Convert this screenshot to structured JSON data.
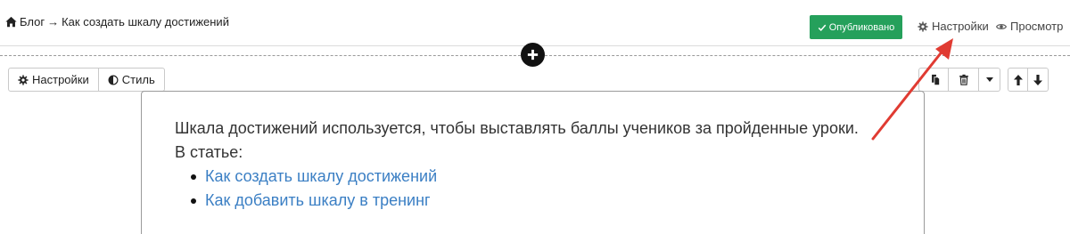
{
  "breadcrumb": {
    "section": "Блог",
    "separator": "→",
    "page": "Как создать шкалу достижений"
  },
  "topbar": {
    "publish_label": "Опубликовано",
    "settings_label": "Настройки",
    "preview_label": "Просмотр"
  },
  "block_toolbar": {
    "settings_tab": "Настройки",
    "style_tab": "Стиль"
  },
  "content": {
    "intro": "Шкала достижений используется, чтобы выставлять баллы учеников за пройденные уроки.",
    "in_article": "В статье:",
    "links": [
      "Как создать шкалу достижений",
      "Как добавить шкалу в тренинг"
    ]
  },
  "colors": {
    "publish_green": "#25a05b",
    "link_blue": "#3b7fc4",
    "annotation_red": "#e03b32"
  },
  "icons": {
    "home": "home-icon",
    "check": "check-icon",
    "gear": "gear-icon",
    "eye": "eye-icon",
    "plus": "plus-circle-icon",
    "contrast": "contrast-icon",
    "copy": "copy-icon",
    "trash": "trash-icon",
    "caret": "caret-down-icon",
    "up": "arrow-up-icon",
    "down": "arrow-down-icon"
  }
}
